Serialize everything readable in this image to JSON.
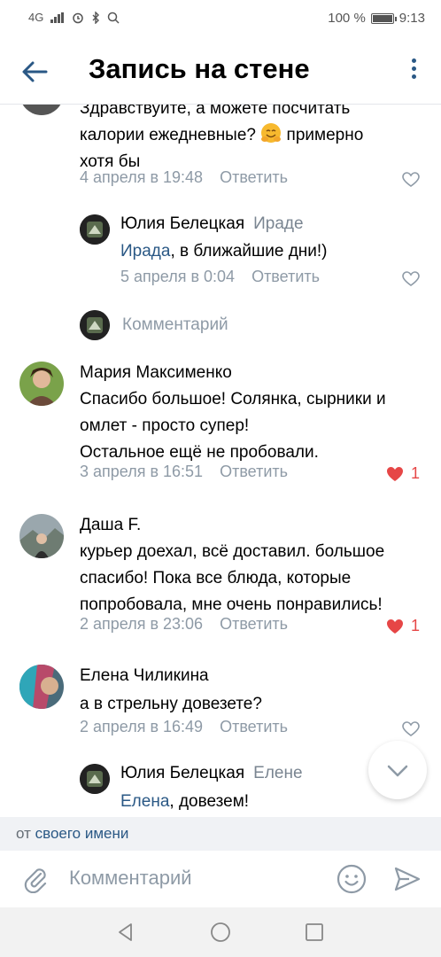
{
  "status": {
    "left_text": "4G",
    "battery_text": "100 %",
    "battery_level": 1.0,
    "time": "9:13"
  },
  "header": {
    "title": "Запись на стене"
  },
  "comments": [
    {
      "text_lines": [
        "Здравствуйте, а можете посчитать",
        "калории ежедневные?",
        "хотя бы"
      ],
      "emoji_after": "примерно",
      "date": "4 апреля в 19:48",
      "reply": "Ответить"
    },
    {
      "name": "Юлия Белецкая",
      "reply_to": "Ираде",
      "link": "Ирада",
      "text": ", в ближайшие дни!)",
      "date": "5 апреля в 0:04",
      "reply": "Ответить"
    },
    {
      "placeholder": "Комментарий"
    },
    {
      "name": "Мария Максименко",
      "text_lines": [
        "Спасибо большое! Солянка, сырники и",
        "омлет - просто супер!",
        "Остальное ещё не пробовали."
      ],
      "date": "3 апреля в 16:51",
      "reply": "Ответить",
      "likes": "1"
    },
    {
      "name": "Даша F.",
      "text_lines": [
        "курьер доехал, всё доставил. большое",
        "спасибо! Пока все блюда, которые",
        "попробовала, мне очень понравились!"
      ],
      "date": "2 апреля в 23:06",
      "reply": "Ответить",
      "likes": "1"
    },
    {
      "name": "Елена Чиликина",
      "text_lines": [
        "а в стрельну довезете?"
      ],
      "date": "2 апреля в 16:49",
      "reply": "Ответить"
    },
    {
      "name": "Юлия Белецкая",
      "reply_to": "Елене",
      "link": "Елена",
      "text": ", довезем!"
    }
  ],
  "from_bar": {
    "prefix": "от",
    "link": "своего имени"
  },
  "composer": {
    "placeholder": "Комментарий"
  },
  "colors": {
    "accent": "#2a5885",
    "like": "#e64646",
    "meta": "#8e9aa6"
  }
}
